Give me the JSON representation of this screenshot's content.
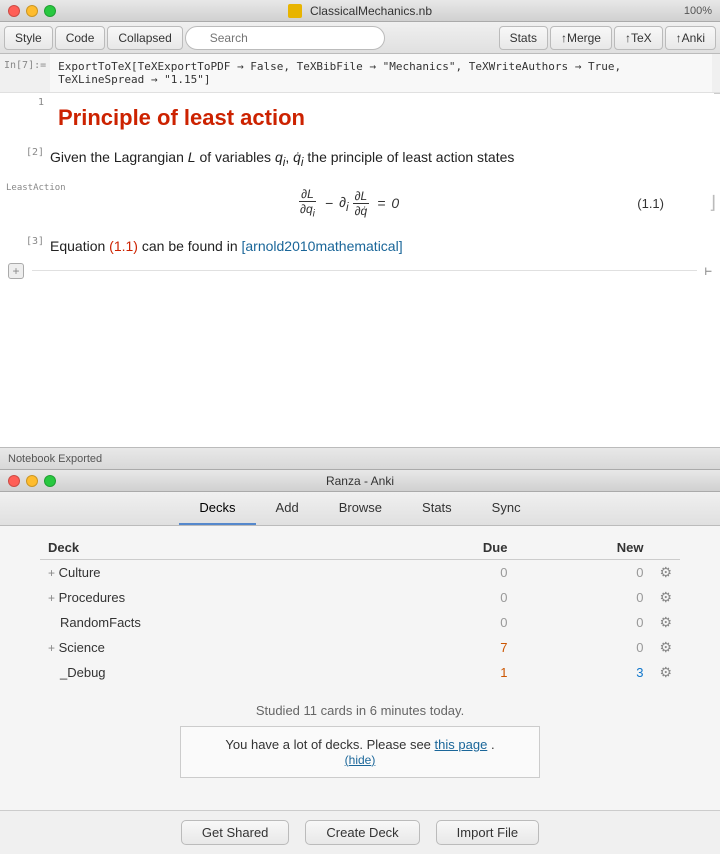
{
  "top_window": {
    "title": "ClassicalMechanics.nb",
    "zoom": "100%",
    "controls": {
      "close": "close",
      "minimize": "minimize",
      "maximize": "maximize"
    },
    "toolbar": {
      "style_label": "Style",
      "code_label": "Code",
      "collapsed_label": "Collapsed",
      "search_placeholder": "Search",
      "stats_label": "Stats",
      "merge_label": "↑Merge",
      "tex_label": "↑TeX",
      "anki_label": "↑Anki"
    },
    "input_cell": {
      "label": "In[7]:=",
      "code": "ExportToTeX[TeXExportToPDF → False, TeXBibFile → \"Mechanics\", TeXWriteAuthors → True, TeXLineSpread → \"1.15\"]"
    },
    "section": {
      "number": "1",
      "title": "Principle of least action",
      "cells": [
        {
          "ref": "[2]",
          "text": "Given the Lagrangian L of variables q_i, q̇_i the principle of least action states"
        },
        {
          "ref": "LeastAction",
          "equation_label": "(1.1)",
          "equation": "∂L/∂q_i − ∂_i ∂L/∂q̇ = 0"
        },
        {
          "ref": "[3]",
          "text_before": "Equation",
          "eq_ref": "(1.1)",
          "text_middle": "can be found in",
          "cite": "[arnold2010mathematical]"
        }
      ]
    },
    "status": "Notebook Exported"
  },
  "anki_window": {
    "title": "Ranza - Anki",
    "controls": {
      "close": "close",
      "minimize": "minimize",
      "maximize": "maximize"
    },
    "nav": {
      "items": [
        "Decks",
        "Add",
        "Browse",
        "Stats",
        "Sync"
      ],
      "active": "Decks"
    },
    "table": {
      "headers": [
        "Deck",
        "Due",
        "New"
      ],
      "rows": [
        {
          "name": "+ Culture",
          "indent": false,
          "plus": true,
          "due": "0",
          "new": "0",
          "gear": true
        },
        {
          "name": "+ Procedures",
          "indent": false,
          "plus": true,
          "due": "0",
          "new": "0",
          "gear": true
        },
        {
          "name": "RandomFacts",
          "indent": true,
          "plus": false,
          "due": "0",
          "new": "0",
          "gear": true
        },
        {
          "name": "+ Science",
          "indent": false,
          "plus": true,
          "due": "7",
          "new": "0",
          "gear": true
        },
        {
          "name": "_Debug",
          "indent": true,
          "plus": false,
          "due": "1",
          "new": "3",
          "gear": true
        }
      ]
    },
    "footer": {
      "studied_text": "Studied 11 cards in 6 minutes today.",
      "notice_before": "You have a lot of decks. Please see",
      "notice_link": "this page",
      "notice_after": ".",
      "hide_label": "hide"
    },
    "bottom_bar": {
      "get_shared": "Get Shared",
      "create_deck": "Create Deck",
      "import_file": "Import File"
    }
  }
}
